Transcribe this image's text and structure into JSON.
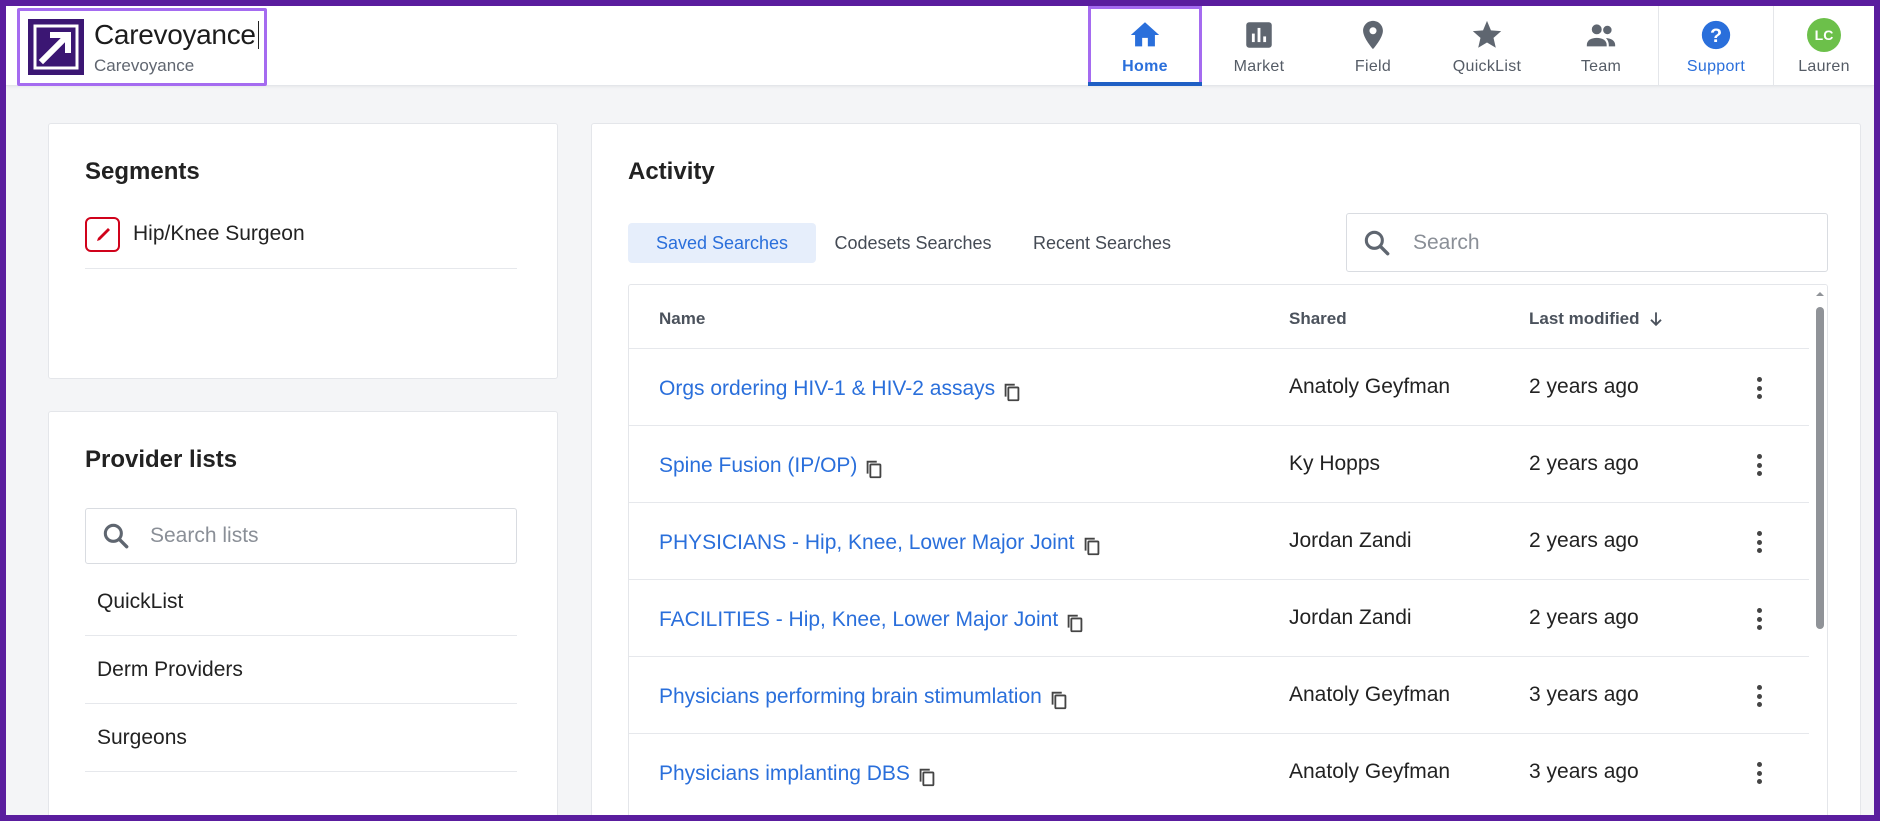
{
  "brand": {
    "name": "Carevoyance",
    "subtitle": "Carevoyance"
  },
  "nav": [
    {
      "label": "Home",
      "icon": "home-icon",
      "active": true
    },
    {
      "label": "Market",
      "icon": "bar-chart-icon"
    },
    {
      "label": "Field",
      "icon": "map-pin-icon"
    },
    {
      "label": "QuickList",
      "icon": "star-icon"
    },
    {
      "label": "Team",
      "icon": "people-icon"
    }
  ],
  "support": {
    "label": "Support",
    "icon": "help-circle-icon"
  },
  "user": {
    "initials": "LC",
    "name": "Lauren"
  },
  "segments": {
    "title": "Segments",
    "items": [
      {
        "label": "Hip/Knee Surgeon",
        "icon": "scalpel-icon"
      }
    ]
  },
  "provider_lists": {
    "title": "Provider lists",
    "search_placeholder": "Search lists",
    "items": [
      {
        "label": "QuickList"
      },
      {
        "label": "Derm Providers"
      },
      {
        "label": "Surgeons"
      }
    ]
  },
  "activity": {
    "title": "Activity",
    "tabs": [
      {
        "label": "Saved Searches",
        "active": true
      },
      {
        "label": "Codesets Searches"
      },
      {
        "label": "Recent Searches"
      }
    ],
    "search_placeholder": "Search",
    "columns": {
      "name": "Name",
      "shared": "Shared",
      "last_modified": "Last modified"
    },
    "rows": [
      {
        "name": "Orgs ordering HIV-1 & HIV-2 assays",
        "shared": "Anatoly Geyfman",
        "modified": "2 years ago"
      },
      {
        "name": "Spine Fusion (IP/OP)",
        "shared": "Ky Hopps",
        "modified": "2 years ago"
      },
      {
        "name": "PHYSICIANS - Hip, Knee, Lower Major Joint",
        "shared": "Jordan Zandi",
        "modified": "2 years ago"
      },
      {
        "name": "FACILITIES - Hip, Knee, Lower Major Joint",
        "shared": "Jordan Zandi",
        "modified": "2 years ago"
      },
      {
        "name": "Physicians performing brain stimumlation",
        "shared": "Anatoly Geyfman",
        "modified": "3 years ago"
      },
      {
        "name": "Physicians implanting DBS",
        "shared": "Anatoly Geyfman",
        "modified": "3 years ago"
      }
    ]
  },
  "colors": {
    "accent": "#2a6fdb",
    "highlight": "#a56bf0",
    "frame": "#5a1d9e",
    "avatar": "#6cc04a",
    "segment": "#d0021b"
  }
}
